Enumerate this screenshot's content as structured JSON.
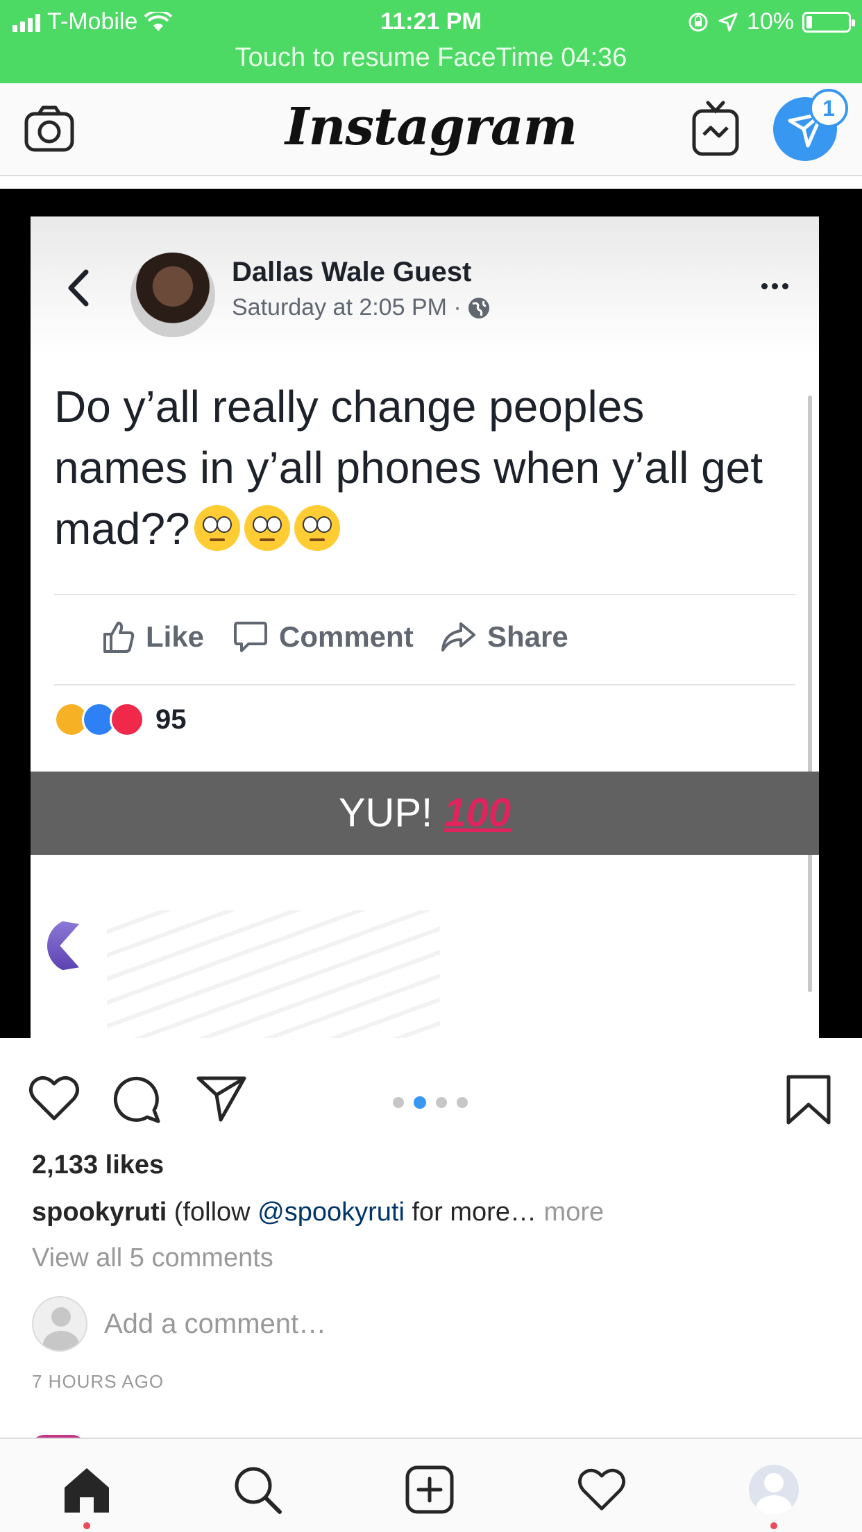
{
  "status_bar": {
    "carrier": "T-Mobile",
    "time": "11:21 PM",
    "battery": "10%",
    "facetime_banner": "Touch to resume FaceTime 04:36"
  },
  "header": {
    "logo": "Instagram",
    "dm_badge": "1"
  },
  "post_image": {
    "author": "Dallas Wale Guest",
    "timestamp": "Saturday at 2:05 PM ·",
    "text": "Do y’all really change peoples names in y’all phones when y’all get mad??",
    "actions": {
      "like": "Like",
      "comment": "Comment",
      "share": "Share"
    },
    "reaction_count": "95",
    "overlay_text": "YUP!",
    "overlay_emoji": "100"
  },
  "post": {
    "likes": "2,133 likes",
    "caption_user": "spookyruti",
    "caption_pre": " (follow ",
    "caption_mention": "@spookyruti",
    "caption_post": " for more… ",
    "caption_more": "more",
    "view_comments": "View all 5 comments",
    "add_comment_placeholder": "Add a comment…",
    "time_ago": "7 HOURS AGO",
    "carousel_index": 2,
    "carousel_count": 4
  },
  "colors": {
    "status_green": "#4cd964",
    "accent_blue": "#3897f0",
    "notification_red": "#ed4956"
  }
}
